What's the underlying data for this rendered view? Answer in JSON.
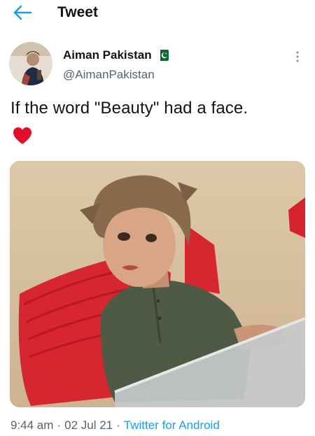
{
  "header": {
    "title": "Tweet",
    "back_icon": "arrow-left-icon",
    "accent": "#1d9bf0"
  },
  "author": {
    "name": "Aiman Pakistan",
    "handle": "@AimanPakistan",
    "flag_icon": "pakistan-flag-icon"
  },
  "tweet": {
    "text": "If the word \"Beauty\" had a face.",
    "emoji": "heart-icon",
    "emoji_color": "#e0102b"
  },
  "media": {
    "kind": "photo"
  },
  "meta": {
    "time": "9:44 am",
    "separator": "·",
    "date": "02 Jul 21",
    "source": "Twitter for Android"
  }
}
